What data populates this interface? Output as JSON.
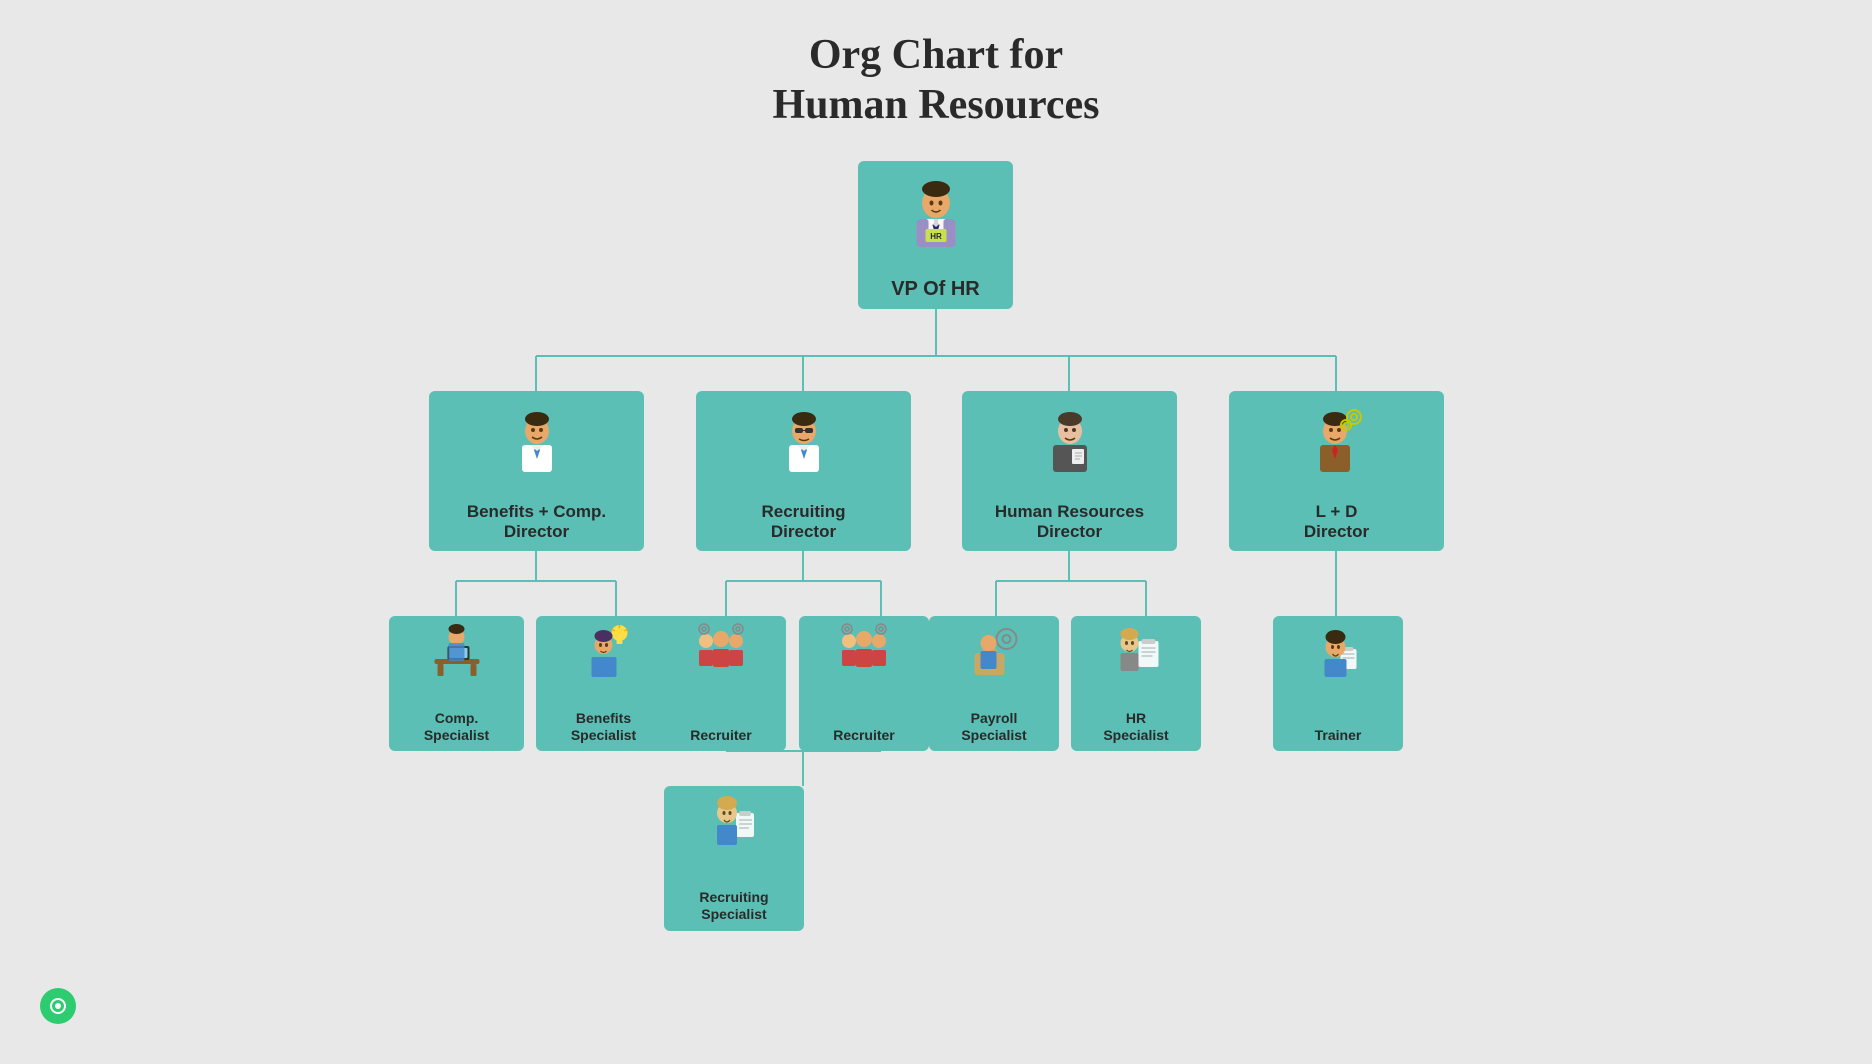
{
  "title_line1": "Org Chart for",
  "title_line2": "Human Resources",
  "root": {
    "label": "VP Of HR",
    "icon": "vp"
  },
  "level1": [
    {
      "label": "Benefits + Comp.\nDirector",
      "icon": "benefits_comp"
    },
    {
      "label": "Recruiting\nDirector",
      "icon": "recruiting"
    },
    {
      "label": "Human Resources\nDirector",
      "icon": "hr_director"
    },
    {
      "label": "L + D\nDirector",
      "icon": "ld"
    }
  ],
  "level2": {
    "benefits_comp": [
      {
        "label": "Comp.\nSpecialist",
        "icon": "comp_specialist"
      },
      {
        "label": "Benefits\nSpecialist",
        "icon": "benefits_specialist"
      }
    ],
    "recruiting": [
      {
        "label": "Recruiter",
        "icon": "recruiter"
      },
      {
        "label": "Recruiter",
        "icon": "recruiter"
      }
    ],
    "hr_director": [
      {
        "label": "Payroll\nSpecialist",
        "icon": "payroll"
      },
      {
        "label": "HR\nSpecialist",
        "icon": "hr_specialist"
      }
    ],
    "ld": [
      {
        "label": "Trainer",
        "icon": "trainer"
      }
    ]
  },
  "level3": {
    "recruiting": [
      {
        "label": "Recruiting\nSpecialist",
        "icon": "recruiting_specialist"
      }
    ]
  },
  "colors": {
    "node_bg": "#5bbfb5",
    "line": "#5bbfb5",
    "bg": "#e8e8e8"
  }
}
